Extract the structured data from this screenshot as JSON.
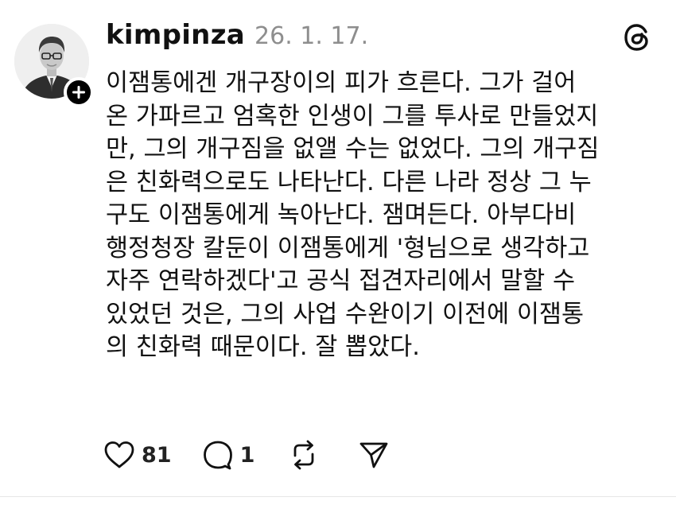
{
  "post": {
    "username": "kimpinza",
    "timestamp": "26. 1. 17.",
    "text_lines": [
      "이잼통에겐 개구장이의 피가 흐른다. 그가 걸어",
      "온 가파르고 엄혹한 인생이 그를 투사로 만들었지",
      "만, 그의 개구짐을 없앨 수는 없었다. 그의 개구짐",
      "은 친화력으로도 나타난다. 다른 나라 정상 그 누",
      "구도 이잼통에게 녹아난다. 잼며든다. 아부다비",
      "행정청장 칼둔이 이잼통에게 '형님으로 생각하고",
      "자주 연락하겠다'고 공식 접견자리에서 말할 수",
      "있었던 것은, 그의 사업 수완이기 이전에 이잼통",
      "의 친화력 때문이다. 잘 뽑았다."
    ]
  },
  "actions": {
    "like_count": "81",
    "reply_count": "1"
  },
  "icons": {
    "avatar": "profile-photo",
    "follow": "plus-icon",
    "brand": "threads-logo-icon",
    "like": "heart-icon",
    "reply": "comment-bubble-icon",
    "repost": "repost-icon",
    "share": "send-icon"
  },
  "colors": {
    "text": "#111111",
    "timestamp": "#8e8e8e",
    "badge": "#000000",
    "background": "#ffffff"
  }
}
